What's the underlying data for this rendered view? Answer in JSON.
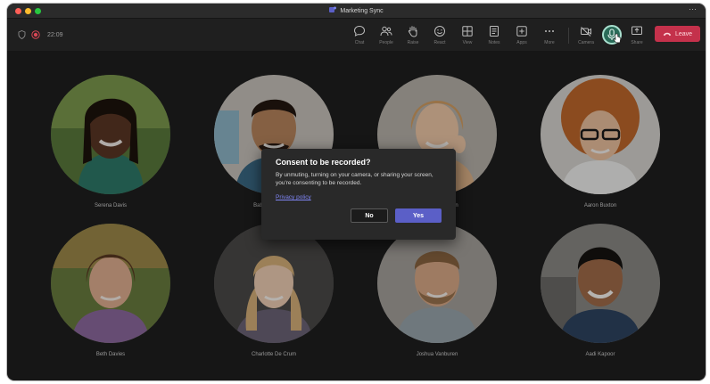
{
  "window": {
    "title": "Marketing Sync",
    "more_glyph": "⋯"
  },
  "toolbar": {
    "timer": "22:09",
    "buttons": [
      {
        "label": "Chat",
        "icon": "chat-icon"
      },
      {
        "label": "People",
        "icon": "people-icon"
      },
      {
        "label": "Raise",
        "icon": "raise-hand-icon"
      },
      {
        "label": "React",
        "icon": "react-icon"
      },
      {
        "label": "View",
        "icon": "view-icon"
      },
      {
        "label": "Notes",
        "icon": "notes-icon"
      },
      {
        "label": "Apps",
        "icon": "apps-icon"
      },
      {
        "label": "More",
        "icon": "more-icon"
      },
      {
        "label": "Camera",
        "icon": "camera-icon"
      },
      {
        "label": "Share",
        "icon": "share-icon"
      }
    ],
    "leave_label": "Leave"
  },
  "participants": [
    {
      "name": "Serena Davis"
    },
    {
      "name": "Babak Shammas"
    },
    {
      "name": "Kristin Patternson"
    },
    {
      "name": "Aaron Buxton"
    },
    {
      "name": "Beth Davies"
    },
    {
      "name": "Charlotte De Crum"
    },
    {
      "name": "Joshua Vanburen"
    },
    {
      "name": "Aadi Kapoor"
    }
  ],
  "dialog": {
    "title": "Consent to be recorded?",
    "body": "By unmuting, turning on your camera, or sharing your screen, you're consenting to be recorded.",
    "link": "Privacy policy",
    "no_label": "No",
    "yes_label": "Yes"
  },
  "colors": {
    "accent": "#5b5fc7",
    "leave": "#c4314b",
    "mic_active": "#2a6b58"
  }
}
